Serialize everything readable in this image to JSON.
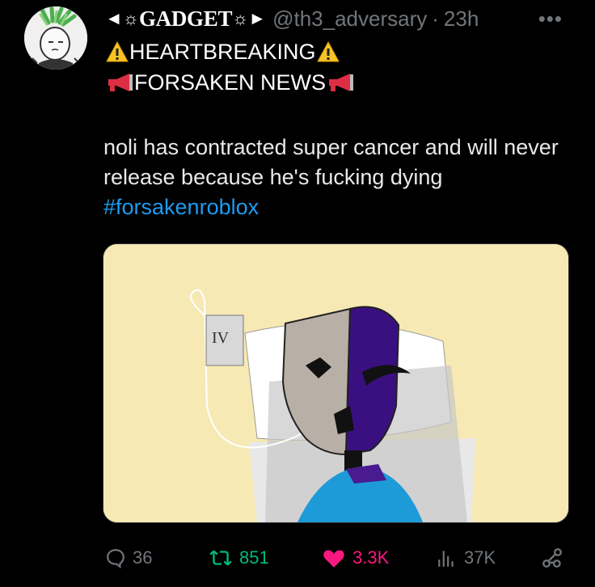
{
  "post": {
    "author": {
      "name": "GADGET",
      "name_prefix": "◄☼",
      "name_suffix": "☼►",
      "handle": "@th3_adversary",
      "separator": "·",
      "time": "23h"
    },
    "more_label": "•••",
    "title_lines": [
      "HEARTBREAKING",
      "FORSAKEN NEWS"
    ],
    "text": "noli has contracted super cancer and will never release because he's fucking dying",
    "hashtag": "#forsakenroblox",
    "media": {
      "iv_label": "IV"
    },
    "stats": {
      "replies": "36",
      "retweets": "851",
      "likes": "3.3K",
      "views": "37K"
    }
  },
  "colors": {
    "background": "#000000",
    "text": "#e7e9ea",
    "muted": "#71767b",
    "link": "#1d9bf0",
    "retweet": "#00ba7c",
    "like": "#f91880"
  },
  "icons": [
    "avatar-image",
    "warning-icon",
    "megaphone-icon",
    "reply-icon",
    "retweet-icon",
    "heart-icon",
    "views-icon",
    "share-icon",
    "more-icon"
  ]
}
